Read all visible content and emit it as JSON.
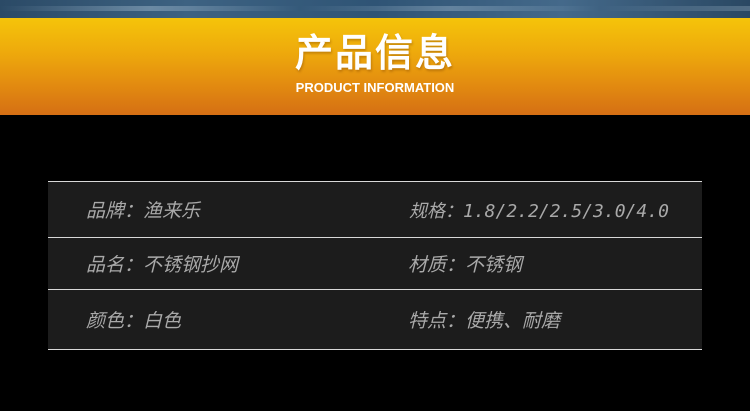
{
  "header": {
    "title": "产品信息",
    "subtitle": "PRODUCT INFORMATION",
    "gradient_top": "#f5c40a",
    "gradient_bottom": "#d56f14"
  },
  "specs": {
    "rows": [
      {
        "left": "品牌：渔来乐",
        "right": "规格：1.8/2.2/2.5/3.0/4.0"
      },
      {
        "left": "品名：不锈钢抄网",
        "right": "材质：不锈钢"
      },
      {
        "left": "颜色：白色",
        "right": "特点：便携、耐磨"
      }
    ],
    "text_color": "#a9a9a9",
    "row_background": "#1c1c1c"
  }
}
